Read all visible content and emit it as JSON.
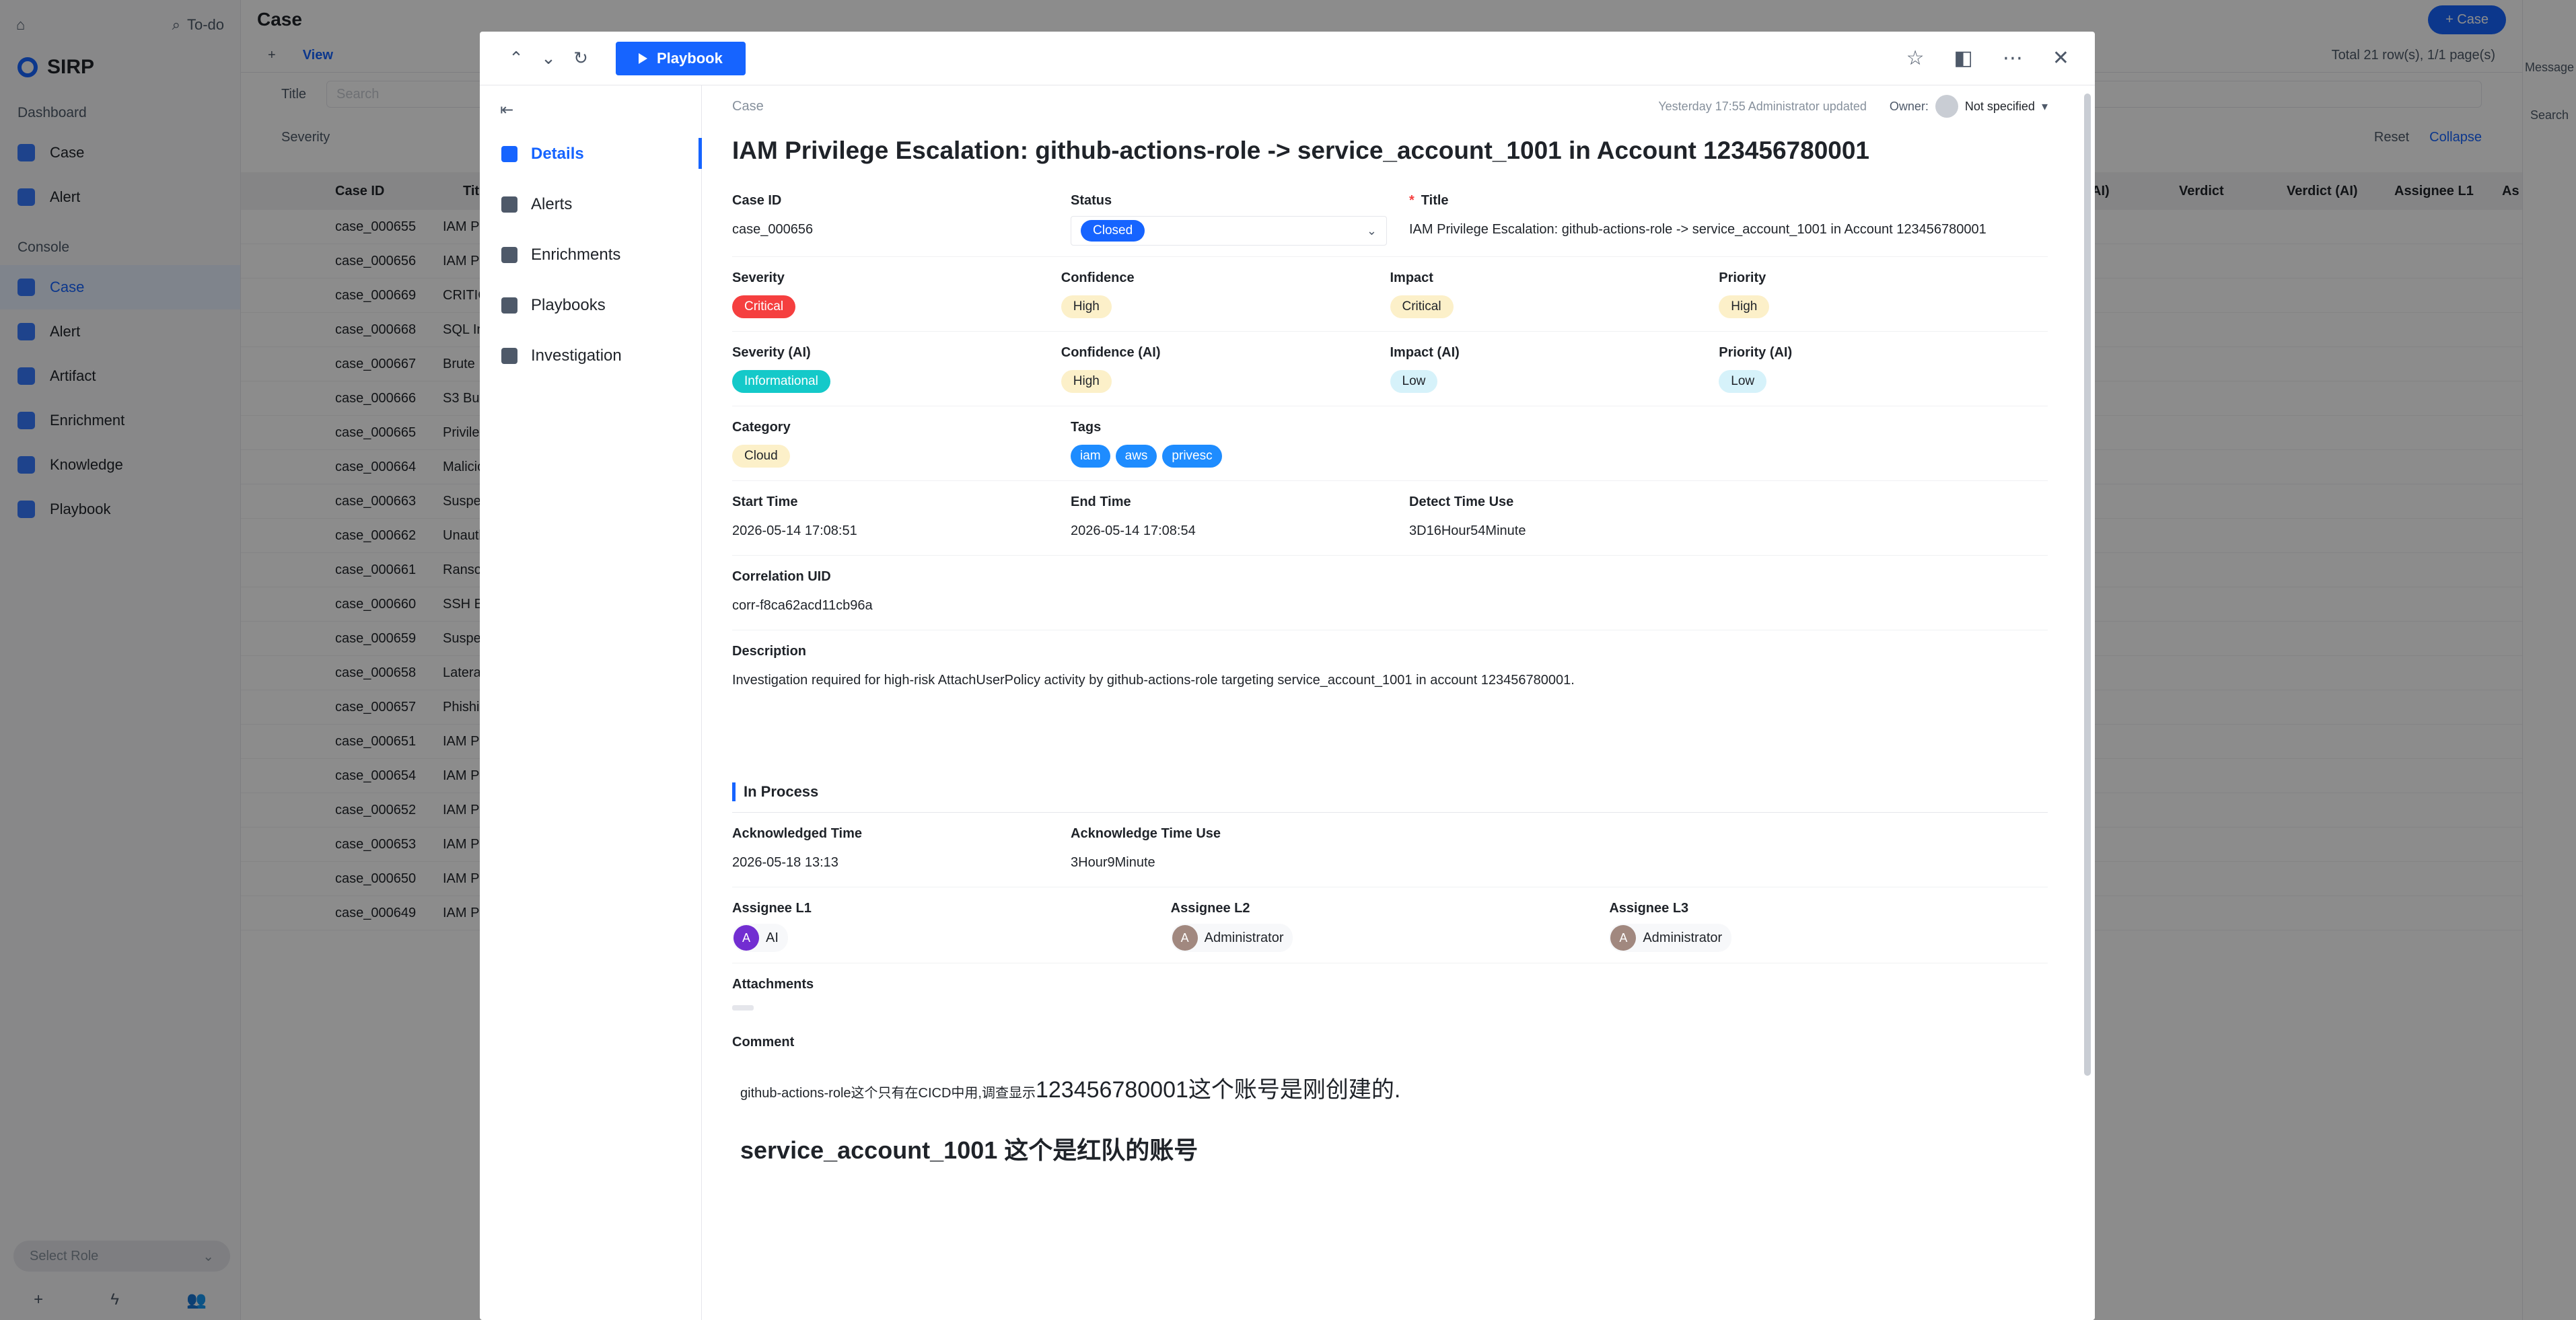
{
  "app": {
    "todo_label": "To-do",
    "brand": "SIRP",
    "sections": {
      "dashboard": "Dashboard",
      "console": "Console"
    },
    "dashboard_items": [
      {
        "label": "Case"
      },
      {
        "label": "Alert"
      }
    ],
    "console_items": [
      {
        "label": "Case"
      },
      {
        "label": "Alert"
      },
      {
        "label": "Artifact"
      },
      {
        "label": "Enrichment"
      },
      {
        "label": "Knowledge"
      },
      {
        "label": "Playbook"
      }
    ],
    "role_placeholder": "Select Role",
    "page_title": "Case",
    "new_case_label": "+ Case",
    "view_label": "View",
    "total_label": "Total 21 row(s), 1/1 page(s)",
    "filter_title": "Title",
    "filter_search": "Search",
    "filter_severity": "Severity",
    "reset_label": "Reset",
    "collapse_label": "Collapse",
    "grid_columns": [
      "Case ID",
      "Title"
    ],
    "grid_right_columns": [
      "ct (AI)",
      "Verdict",
      "Verdict (AI)",
      "Assignee L1",
      "As"
    ],
    "grid_rows": [
      {
        "id": "case_000655",
        "title": "IAM Pr"
      },
      {
        "id": "case_000656",
        "title": "IAM Pr"
      },
      {
        "id": "case_000669",
        "title": "CRITIC"
      },
      {
        "id": "case_000668",
        "title": "SQL In"
      },
      {
        "id": "case_000667",
        "title": "Brute F"
      },
      {
        "id": "case_000666",
        "title": "S3 Bu"
      },
      {
        "id": "case_000665",
        "title": "Privile"
      },
      {
        "id": "case_000664",
        "title": "Malicio"
      },
      {
        "id": "case_000663",
        "title": "Suspe"
      },
      {
        "id": "case_000662",
        "title": "Unauth"
      },
      {
        "id": "case_000661",
        "title": "Ranso"
      },
      {
        "id": "case_000660",
        "title": "SSH B"
      },
      {
        "id": "case_000659",
        "title": "Suspe"
      },
      {
        "id": "case_000658",
        "title": "Latera"
      },
      {
        "id": "case_000657",
        "title": "Phishi"
      },
      {
        "id": "case_000651",
        "title": "IAM Pr"
      },
      {
        "id": "case_000654",
        "title": "IAM Pr"
      },
      {
        "id": "case_000652",
        "title": "IAM Pr"
      },
      {
        "id": "case_000653",
        "title": "IAM Pr"
      },
      {
        "id": "case_000650",
        "title": "IAM Pr"
      },
      {
        "id": "case_000649",
        "title": "IAM Pr"
      }
    ],
    "right_rail": [
      "Message",
      "Search"
    ]
  },
  "modal": {
    "playbook_button": "Playbook",
    "nav": [
      {
        "label": "Details",
        "icon": "details-icon"
      },
      {
        "label": "Alerts",
        "icon": "bell-icon"
      },
      {
        "label": "Enrichments",
        "icon": "enrichment-icon"
      },
      {
        "label": "Playbooks",
        "icon": "playbook-icon"
      },
      {
        "label": "Investigation",
        "icon": "investigation-icon"
      }
    ],
    "breadcrumb": "Case",
    "updated_text": "Yesterday 17:55 Administrator updated",
    "owner_label": "Owner:",
    "owner_value": "Not specified",
    "title": "IAM Privilege Escalation: github-actions-role -> service_account_1001 in Account 123456780001",
    "fields": {
      "case_id_label": "Case ID",
      "case_id": "case_000656",
      "status_label": "Status",
      "status": "Closed",
      "title_label": "Title",
      "title_value": "IAM Privilege Escalation: github-actions-role -> service_account_1001 in Account 123456780001",
      "severity_label": "Severity",
      "severity": "Critical",
      "confidence_label": "Confidence",
      "confidence": "High",
      "impact_label": "Impact",
      "impact": "Critical",
      "priority_label": "Priority",
      "priority": "High",
      "severity_ai_label": "Severity (AI)",
      "severity_ai": "Informational",
      "confidence_ai_label": "Confidence (AI)",
      "confidence_ai": "High",
      "impact_ai_label": "Impact (AI)",
      "impact_ai": "Low",
      "priority_ai_label": "Priority (AI)",
      "priority_ai": "Low",
      "category_label": "Category",
      "category": "Cloud",
      "tags_label": "Tags",
      "tags": [
        "iam",
        "aws",
        "privesc"
      ],
      "start_time_label": "Start Time",
      "start_time": "2026-05-14 17:08:51",
      "end_time_label": "End Time",
      "end_time": "2026-05-14 17:08:54",
      "detect_time_use_label": "Detect Time Use",
      "detect_time_use": "3D16Hour54Minute",
      "correlation_uid_label": "Correlation UID",
      "correlation_uid": "corr-f8ca62acd11cb96a",
      "description_label": "Description",
      "description": "Investigation required for high-risk AttachUserPolicy activity by github-actions-role targeting service_account_1001 in account 123456780001."
    },
    "in_process": {
      "title": "In Process",
      "ack_time_label": "Acknowledged Time",
      "ack_time": "2026-05-18 13:13",
      "ack_time_use_label": "Acknowledge Time Use",
      "ack_time_use": "3Hour9Minute",
      "assignee_l1_label": "Assignee L1",
      "assignee_l1": "AI",
      "assignee_l1_initial": "A",
      "assignee_l2_label": "Assignee L2",
      "assignee_l2": "Administrator",
      "assignee_l2_initial": "A",
      "assignee_l3_label": "Assignee L3",
      "assignee_l3": "Administrator",
      "assignee_l3_initial": "A",
      "attachments_label": "Attachments",
      "comment_label": "Comment",
      "comment_line1_small": "github-actions-role这个只有在CICD中用,调查显示",
      "comment_line1_big": "123456780001这个账号是刚创建的.",
      "comment_line2": "service_account_1001 这个是红队的账号"
    }
  },
  "colors": {
    "accent": "#1664ff",
    "critical": "#f53f3f",
    "informational": "#14c9c9"
  }
}
